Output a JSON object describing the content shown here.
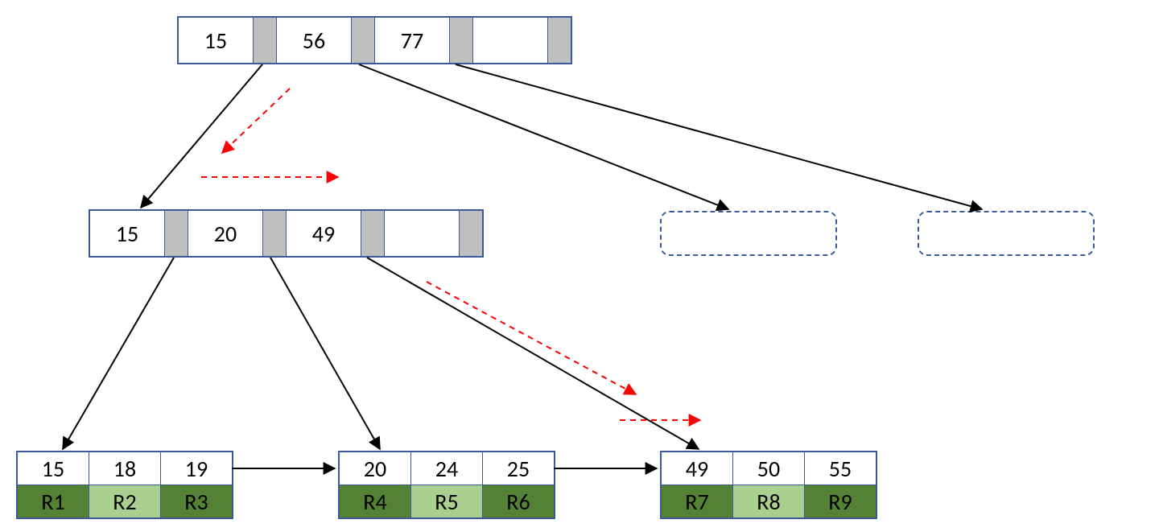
{
  "root_node": {
    "keys": [
      "15",
      "56",
      "77"
    ],
    "empty_slots": 1
  },
  "child_node": {
    "keys": [
      "15",
      "20",
      "49"
    ],
    "empty_slots": 1
  },
  "leaves": [
    {
      "keys": [
        "15",
        "18",
        "19"
      ],
      "records": [
        "R1",
        "R2",
        "R3"
      ]
    },
    {
      "keys": [
        "20",
        "24",
        "25"
      ],
      "records": [
        "R4",
        "R5",
        "R6"
      ]
    },
    {
      "keys": [
        "49",
        "50",
        "55"
      ],
      "records": [
        "R7",
        "R8",
        "R9"
      ]
    }
  ],
  "colors": {
    "border": "#3a5a9a",
    "pointer_fill": "#bfbfbf",
    "record_dark": "#548235",
    "record_light": "#a9d08e",
    "trace_arrow": "#ff0000"
  }
}
